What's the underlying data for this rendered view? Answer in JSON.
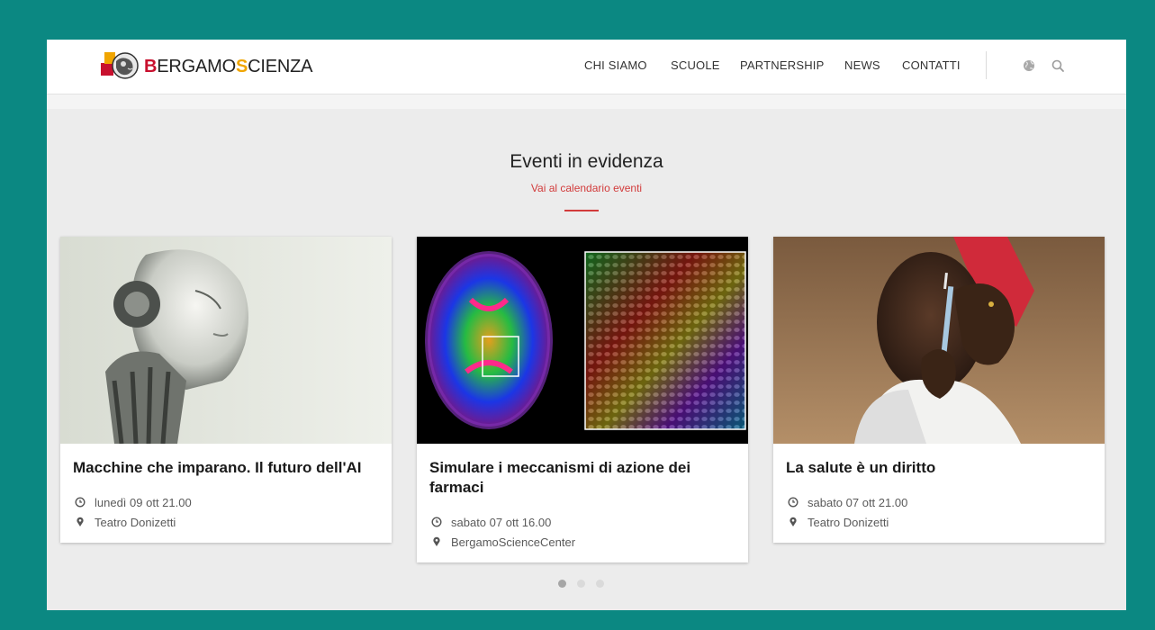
{
  "brand": {
    "logo_parts": [
      "B",
      "ERGAMO",
      "S",
      "CIENZA"
    ],
    "colors": {
      "red": "#c8102e",
      "yellow": "#f0a500",
      "accent": "#d23b3b",
      "frame": "#0b8882"
    }
  },
  "nav": {
    "items": [
      "CHI SIAMO",
      "SCUOLE",
      "PARTNERSHIP",
      "NEWS",
      "CONTATTI"
    ],
    "icons": [
      "globe-icon",
      "search-icon"
    ]
  },
  "section": {
    "title": "Eventi in evidenza",
    "link": "Vai al calendario eventi"
  },
  "events": [
    {
      "title": "Macchine che imparano. Il futuro dell'AI",
      "datetime": "lunedì 09 ott 21.00",
      "location": "Teatro Donizetti",
      "image": "humanoid-robot-head-photo"
    },
    {
      "title": "Simulare i meccanismi di azione dei farmaci",
      "datetime": "sabato 07 ott 16.00",
      "location": "BergamoScienceCenter",
      "image": "brain-scan-colormap-photo"
    },
    {
      "title": "La salute è un diritto",
      "datetime": "sabato 07 ott 21.00",
      "location": "Teatro Donizetti",
      "image": "woman-with-syringe-photo"
    }
  ],
  "carousel": {
    "page_count": 3,
    "active_page": 1
  }
}
